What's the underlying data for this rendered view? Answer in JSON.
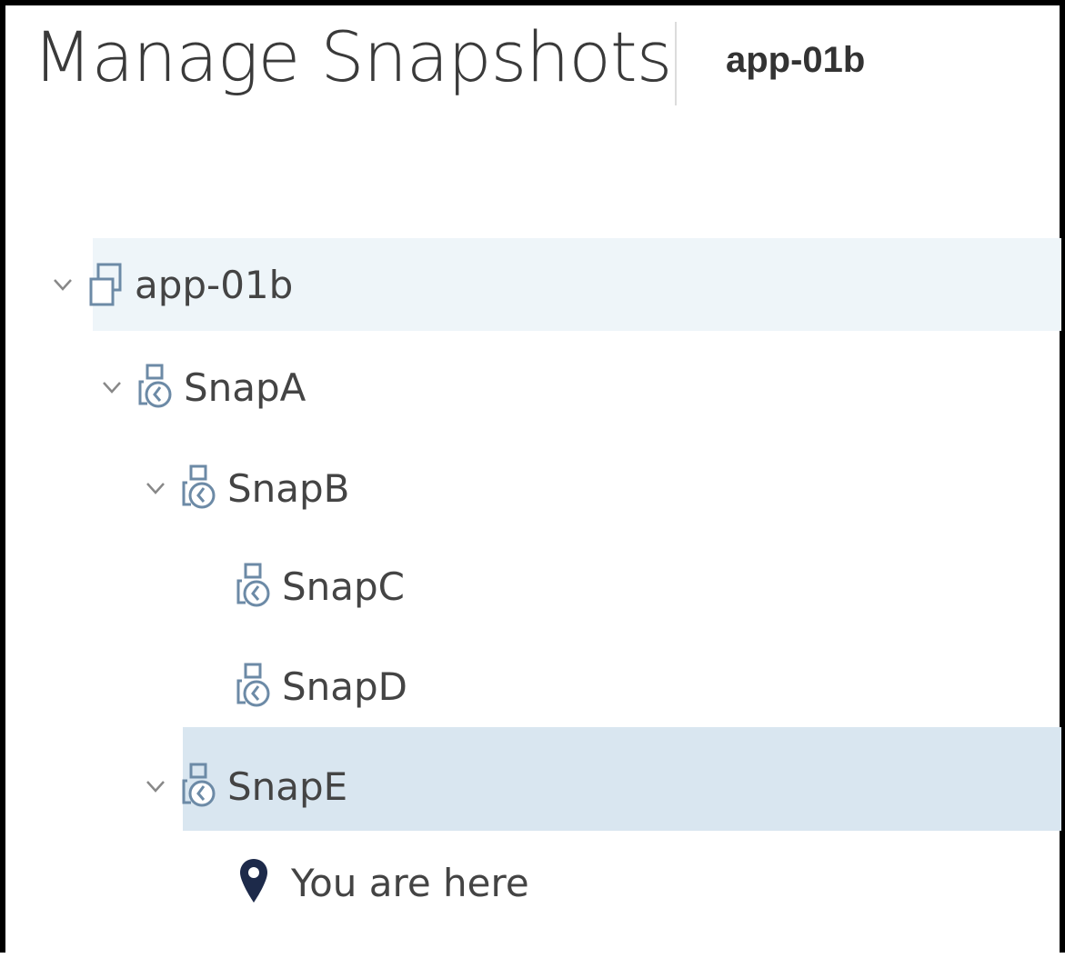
{
  "header": {
    "title": "Manage Snapshots",
    "vm_name": "app-01b"
  },
  "tree": {
    "root": {
      "label": "app-01b",
      "icon": "vm-icon",
      "expanded": true
    },
    "snapshots": [
      {
        "label": "SnapA",
        "icon": "snapshot-icon",
        "expanded": true
      },
      {
        "label": "SnapB",
        "icon": "snapshot-icon",
        "expanded": true
      },
      {
        "label": "SnapC",
        "icon": "snapshot-icon"
      },
      {
        "label": "SnapD",
        "icon": "snapshot-icon"
      },
      {
        "label": "SnapE",
        "icon": "snapshot-icon",
        "expanded": true,
        "selected": true
      }
    ],
    "current_state": {
      "label": "You are here",
      "icon": "location-pin-icon"
    }
  },
  "colors": {
    "root_row_bg": "#eef5f9",
    "selected_row_bg": "#d9e6f0",
    "icon_stroke": "#6c8aa6",
    "pin": "#1d2a4a"
  }
}
